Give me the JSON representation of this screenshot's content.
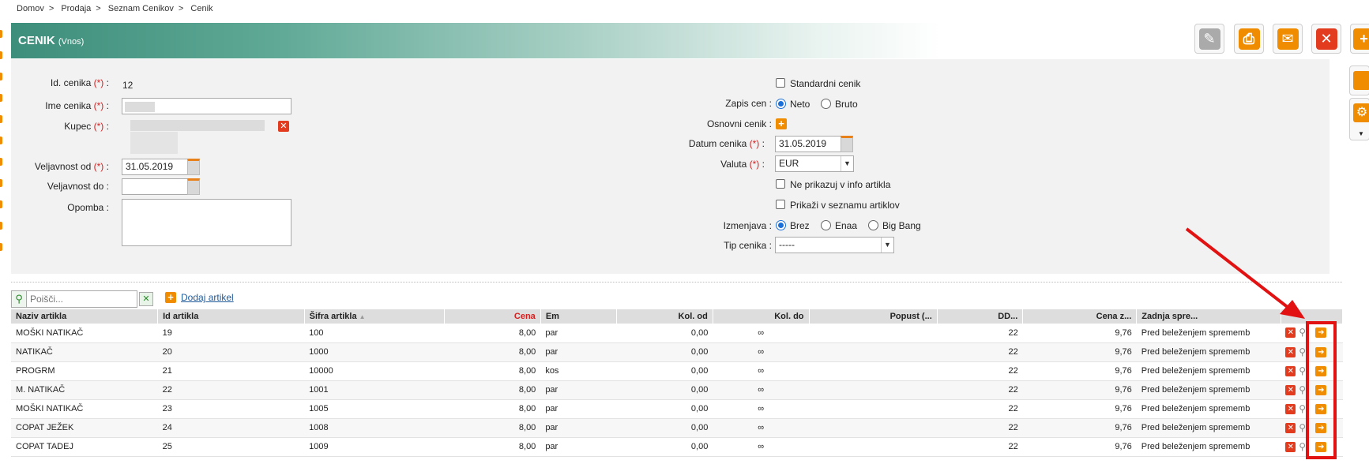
{
  "breadcrumb": [
    "Domov",
    ">",
    "Prodaja",
    ">",
    "Seznam Cenikov",
    ">",
    "Cenik"
  ],
  "title": {
    "main": "CENIK",
    "sub": "(Vnos)"
  },
  "toolbar": {
    "edit": "✎",
    "print": "⎙",
    "mail": "✉",
    "close": "✕",
    "add": "+"
  },
  "form": {
    "id_label": "Id. cenika",
    "id_value": "12",
    "name_label": "Ime cenika",
    "buyer_label": "Kupec",
    "valid_from_label": "Veljavnost od",
    "valid_from_value": "31.05.2019",
    "valid_to_label": "Veljavnost do",
    "valid_to_value": "",
    "note_label": "Opomba",
    "standard_label": "Standardni cenik",
    "price_record_label": "Zapis cen",
    "neto": "Neto",
    "bruto": "Bruto",
    "base_label": "Osnovni cenik",
    "date_label": "Datum cenika",
    "date_value": "31.05.2019",
    "currency_label": "Valuta",
    "currency_value": "EUR",
    "no_info_label": "Ne prikazuj v info artikla",
    "show_list_label": "Prikaži v seznamu artiklov",
    "change_label": "Izmenjava",
    "brez": "Brez",
    "enaa": "Enaa",
    "bigbang": "Big Bang",
    "type_label": "Tip cenika",
    "type_value": "-----",
    "req": "(*)",
    "colon": ":"
  },
  "search": {
    "placeholder": "Poišči...",
    "add_label": "Dodaj artikel"
  },
  "table": {
    "headers": [
      "Naziv artikla",
      "Id artikla",
      "Šifra artikla",
      "Cena",
      "Em",
      "Kol. od",
      "Kol. do",
      "Popust (...",
      "DD...",
      "Cena z...",
      "Zadnja spre..."
    ],
    "rows": [
      [
        "MOŠKI NATIKAČ",
        "19",
        "100",
        "8,00",
        "par",
        "0,00",
        "∞",
        "",
        "22",
        "9,76",
        "Pred beleženjem sprememb"
      ],
      [
        "NATIKAČ",
        "20",
        "1000",
        "8,00",
        "par",
        "0,00",
        "∞",
        "",
        "22",
        "9,76",
        "Pred beleženjem sprememb"
      ],
      [
        "PROGRM",
        "21",
        "10000",
        "8,00",
        "kos",
        "0,00",
        "∞",
        "",
        "22",
        "9,76",
        "Pred beleženjem sprememb"
      ],
      [
        "M. NATIKAČ",
        "22",
        "1001",
        "8,00",
        "par",
        "0,00",
        "∞",
        "",
        "22",
        "9,76",
        "Pred beleženjem sprememb"
      ],
      [
        "MOŠKI NATIKAČ",
        "23",
        "1005",
        "8,00",
        "par",
        "0,00",
        "∞",
        "",
        "22",
        "9,76",
        "Pred beleženjem sprememb"
      ],
      [
        "COPAT JEŽEK",
        "24",
        "1008",
        "8,00",
        "par",
        "0,00",
        "∞",
        "",
        "22",
        "9,76",
        "Pred beleženjem sprememb"
      ],
      [
        "COPAT TADEJ",
        "25",
        "1009",
        "8,00",
        "par",
        "0,00",
        "∞",
        "",
        "22",
        "9,76",
        "Pred beleženjem sprememb"
      ]
    ]
  },
  "colors": {
    "accent": "#f08c00",
    "danger": "#e33b1e",
    "header": "#3d8e7b",
    "highlight": "#e31212"
  }
}
